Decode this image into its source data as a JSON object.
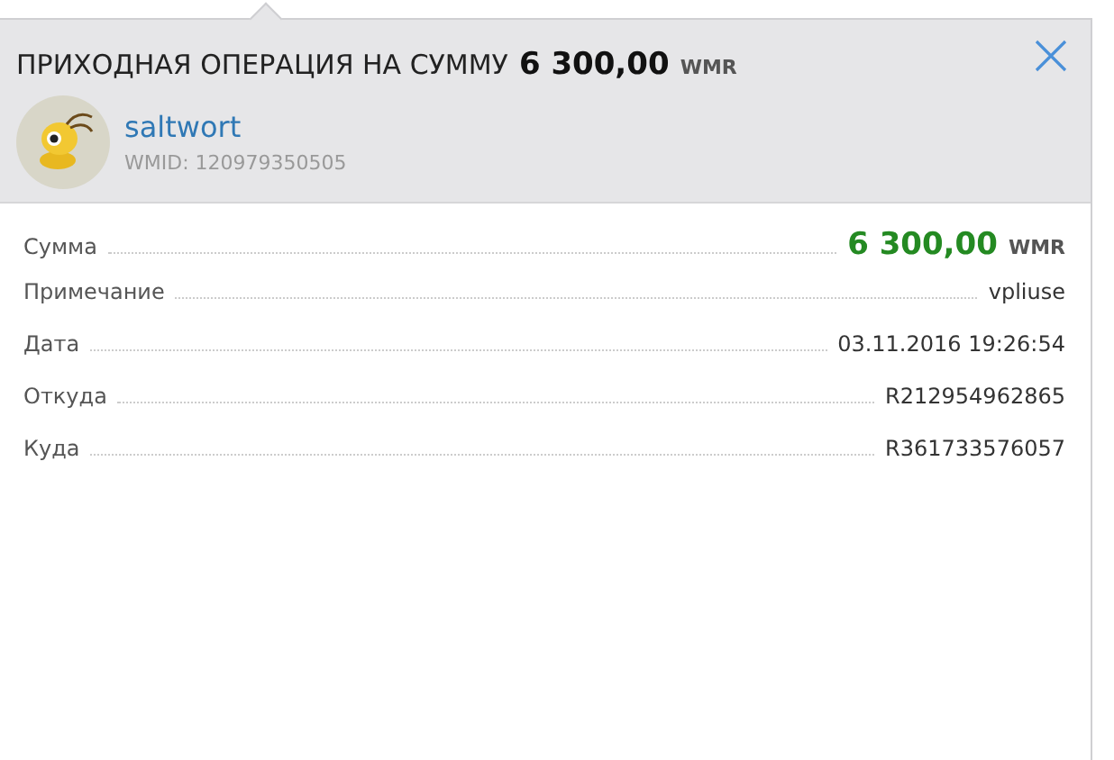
{
  "header": {
    "title": "ПРИХОДНАЯ ОПЕРАЦИЯ НА СУММУ",
    "amount": "6 300,00",
    "currency": "WMR"
  },
  "user": {
    "name": "saltwort",
    "wmid": "WMID: 120979350505"
  },
  "details": [
    {
      "kind": "amount",
      "label": "Сумма",
      "value": "6 300,00",
      "currency": "WMR"
    },
    {
      "kind": "text",
      "label": "Примечание",
      "value": "vpliuse"
    },
    {
      "kind": "text",
      "label": "Дата",
      "value": "03.11.2016 19:26:54"
    },
    {
      "kind": "text",
      "label": "Откуда",
      "value": "R212954962865"
    },
    {
      "kind": "text",
      "label": "Куда",
      "value": "R361733576057"
    }
  ]
}
